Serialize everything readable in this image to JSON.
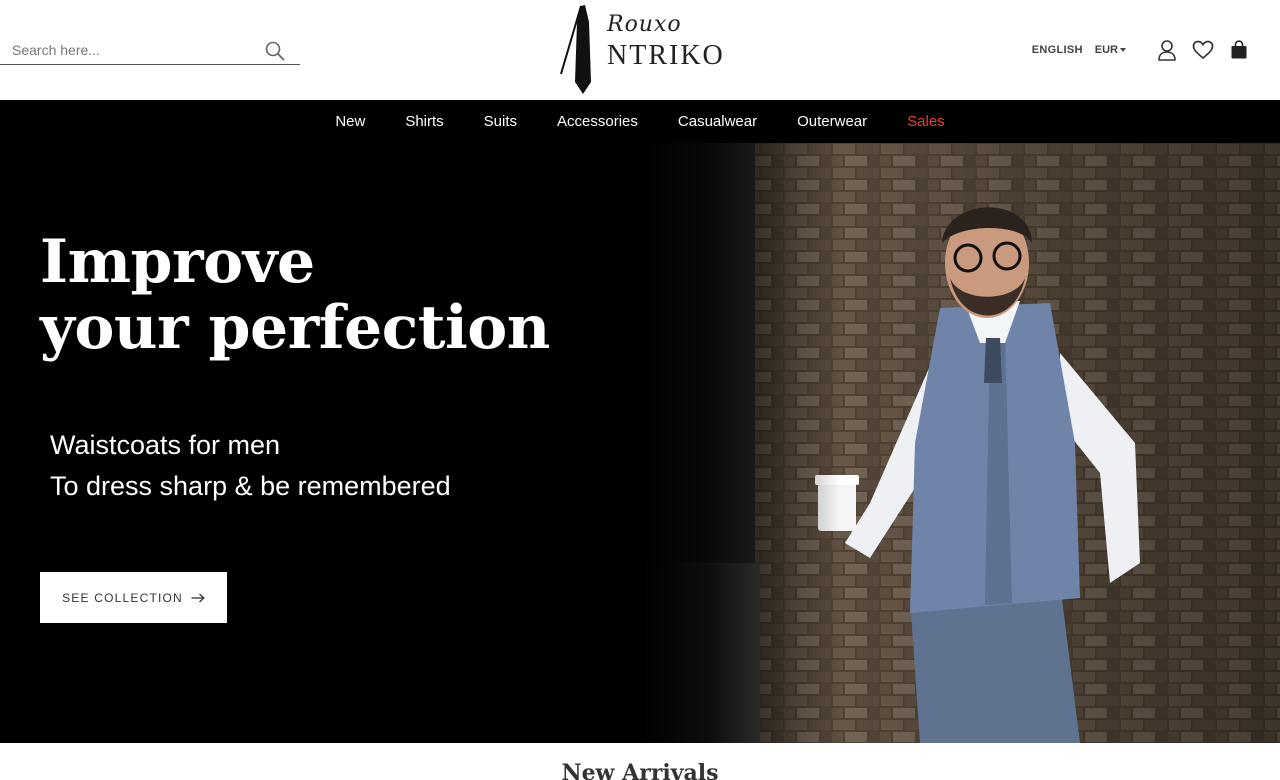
{
  "search": {
    "placeholder": "Search here..."
  },
  "logo": {
    "script": "Rouxo",
    "brand": "NTRIKO"
  },
  "header": {
    "language": "ENGLISH",
    "currency": "EUR"
  },
  "nav": {
    "items": [
      {
        "label": "New"
      },
      {
        "label": "Shirts"
      },
      {
        "label": "Suits"
      },
      {
        "label": "Accessories"
      },
      {
        "label": "Casualwear"
      },
      {
        "label": "Outerwear"
      },
      {
        "label": "Sales"
      }
    ]
  },
  "hero": {
    "title_line1": "Improve",
    "title_line2": "your perfection",
    "subtitle_line1": "Waistcoats for men",
    "subtitle_line2": "To dress sharp & be remembered",
    "cta_label": "SEE COLLECTION"
  },
  "section": {
    "title": "New Arrivals"
  },
  "colors": {
    "accent_sales": "#e8412c",
    "nav_bg": "#000000"
  },
  "icons": [
    "search-icon",
    "user-icon",
    "heart-icon",
    "bag-icon",
    "arrow-right-icon",
    "tie-icon"
  ]
}
